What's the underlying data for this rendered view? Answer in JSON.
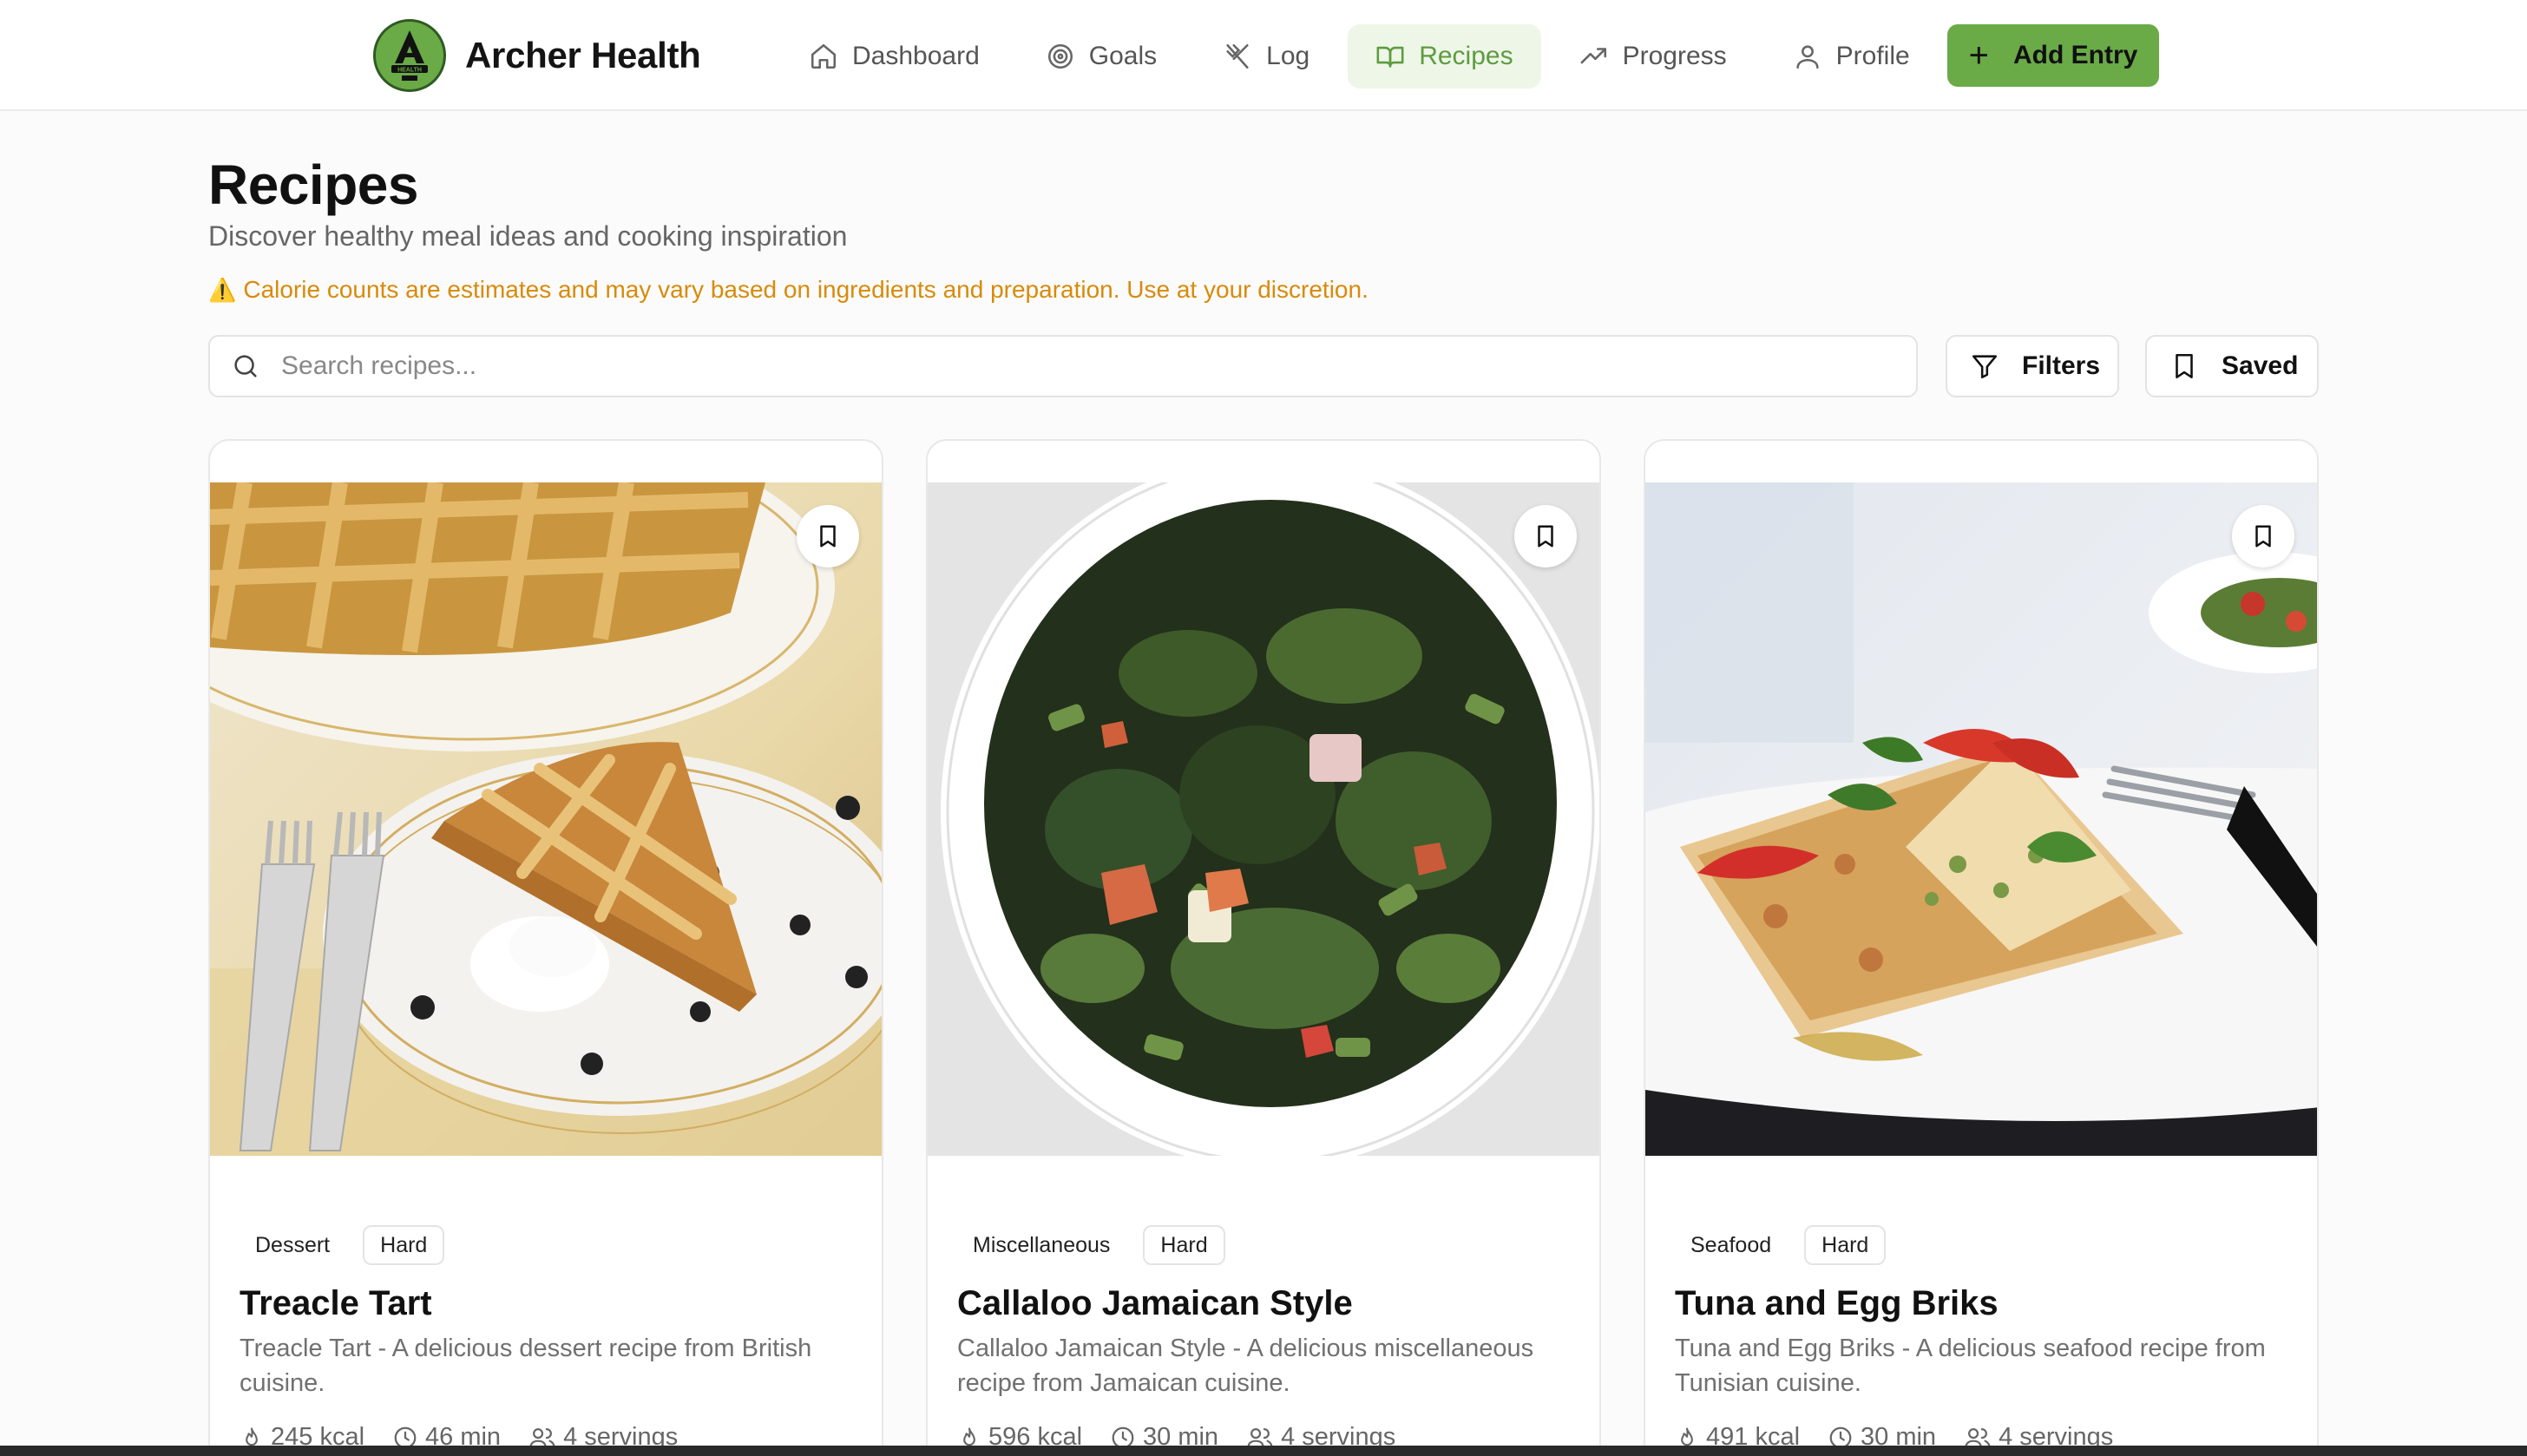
{
  "brand": {
    "name": "Archer Health",
    "logo_text": "HEALTH"
  },
  "nav": {
    "items": [
      {
        "label": "Dashboard",
        "icon": "home-icon"
      },
      {
        "label": "Goals",
        "icon": "target-icon"
      },
      {
        "label": "Log",
        "icon": "utensils-icon"
      },
      {
        "label": "Recipes",
        "icon": "book-open-icon",
        "active": true
      },
      {
        "label": "Progress",
        "icon": "trending-up-icon"
      },
      {
        "label": "Profile",
        "icon": "user-icon"
      }
    ],
    "add_entry": "Add Entry"
  },
  "page": {
    "title": "Recipes",
    "subtitle": "Discover healthy meal ideas and cooking inspiration",
    "warning": "Calorie counts are estimates and may vary based on ingredients and preparation. Use at your discretion."
  },
  "search": {
    "placeholder": "Search recipes...",
    "value": ""
  },
  "toolbar": {
    "filters": "Filters",
    "saved": "Saved"
  },
  "colors": {
    "accent": "#6aaa47",
    "active_nav_bg": "#eef6e8",
    "active_nav_text": "#5d9c3f",
    "warning": "#d98a0a"
  },
  "recipes": [
    {
      "category": "Dessert",
      "difficulty": "Hard",
      "title": "Treacle Tart",
      "description": "Treacle Tart - A delicious dessert recipe from British cuisine.",
      "kcal": "245 kcal",
      "time": "46 min",
      "servings": "4 servings"
    },
    {
      "category": "Miscellaneous",
      "difficulty": "Hard",
      "title": "Callaloo Jamaican Style",
      "description": "Callaloo Jamaican Style - A delicious miscellaneous recipe from Jamaican cuisine.",
      "kcal": "596 kcal",
      "time": "30 min",
      "servings": "4 servings"
    },
    {
      "category": "Seafood",
      "difficulty": "Hard",
      "title": "Tuna and Egg Briks",
      "description": "Tuna and Egg Briks - A delicious seafood recipe from Tunisian cuisine.",
      "kcal": "491 kcal",
      "time": "30 min",
      "servings": "4 servings"
    }
  ]
}
